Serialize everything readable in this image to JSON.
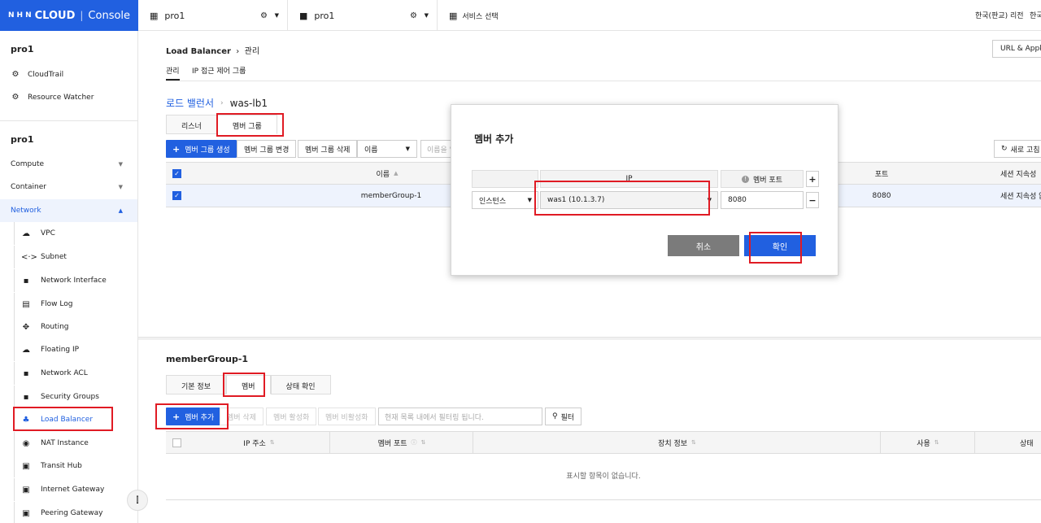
{
  "topbar": {
    "logo_nhn": "NHN",
    "logo_cloud": "CLOUD",
    "logo_console": "Console",
    "project_tabs": [
      "pro1",
      "pro1"
    ],
    "service_select": "서비스 선택",
    "region": "한국(판교) 리전",
    "lang": "한국"
  },
  "sidebar": {
    "org_project": "pro1",
    "org_items": [
      "CloudTrail",
      "Resource Watcher"
    ],
    "project": "pro1",
    "categories": [
      "Compute",
      "Container",
      "Network"
    ],
    "network_items": [
      "VPC",
      "Subnet",
      "Network Interface",
      "Flow Log",
      "Routing",
      "Floating IP",
      "Network ACL",
      "Security Groups",
      "Load Balancer",
      "NAT Instance",
      "Transit Hub",
      "Internet Gateway",
      "Peering Gateway"
    ]
  },
  "main": {
    "breadcrumb_service": "Load Balancer",
    "breadcrumb_page": "관리",
    "url_btn": "URL & Appkey",
    "subtabs": [
      "관리",
      "IP 접근 제어 그룹"
    ],
    "lb_link": "로드 밸런서",
    "lb_name": "was-lb1",
    "lb_tabs": [
      "리스너",
      "멤버 그룹"
    ],
    "toolbar": {
      "create": "멤버 그룹 생성",
      "modify": "멤버 그룹 변경",
      "delete": "멤버 그룹 삭제",
      "filter_select": "이름",
      "filter_placeholder": "이름을 입력하세요",
      "refresh": "새로 고침"
    },
    "table": {
      "headers": [
        "이름",
        "포트",
        "세션 지속성"
      ],
      "rows": [
        {
          "name": "memberGroup-1",
          "port": "8080",
          "session": "세션 지속성 없음"
        }
      ]
    }
  },
  "detail": {
    "title": "memberGroup-1",
    "tabs": [
      "기본 정보",
      "멤버",
      "상태 확인"
    ],
    "toolbar": {
      "add": "멤버 추가",
      "delete": "멤버 삭제",
      "enable": "멤버 활성화",
      "disable": "멤버 비활성화",
      "filter_placeholder": "현재 목록 내에서 필터링 됩니다.",
      "filter_btn": "필터"
    },
    "headers": [
      "IP 주소",
      "멤버 포트",
      "장치 정보",
      "사용",
      "상태"
    ],
    "empty": "표시할 항목이 없습니다."
  },
  "modal": {
    "title": "멤버 추가",
    "col_ip": "IP",
    "col_port": "멤버 포트",
    "type": "인스턴스",
    "ip_value": "was1 (10.1.3.7)",
    "port_value": "8080",
    "cancel": "취소",
    "ok": "확인"
  },
  "colors": {
    "accent": "#2160e0",
    "highlight": "#e01b24"
  }
}
